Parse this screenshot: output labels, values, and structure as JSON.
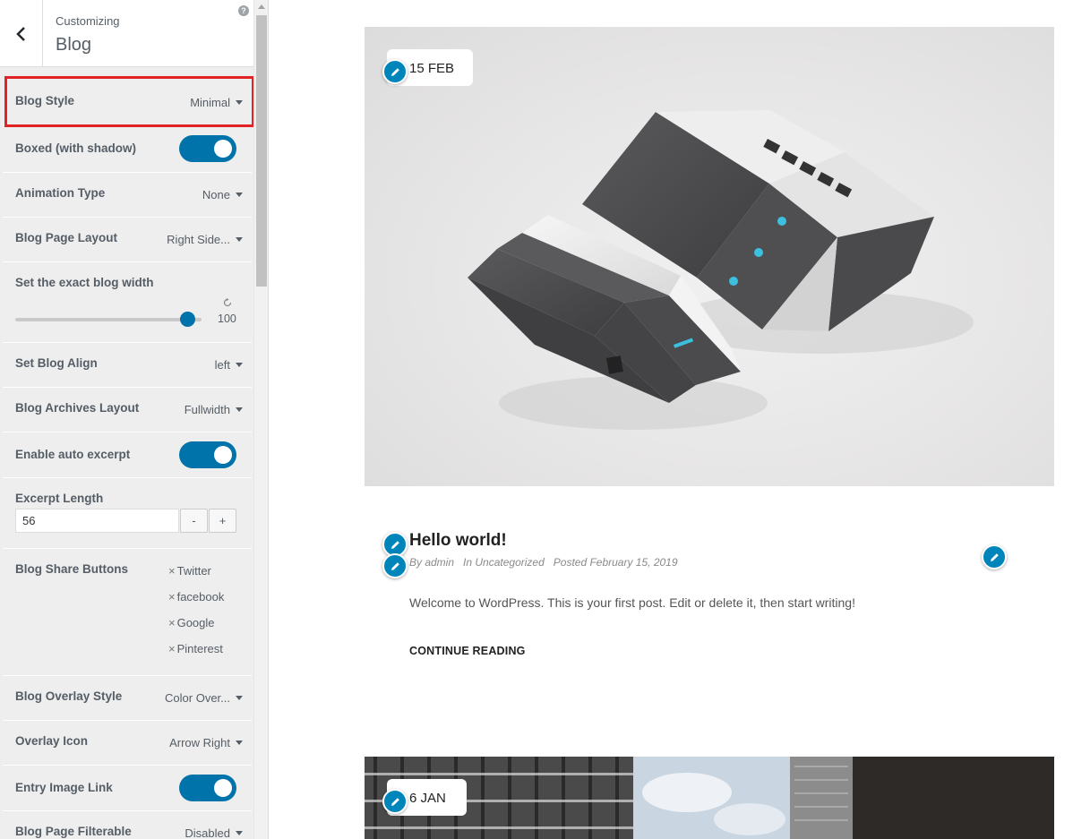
{
  "header": {
    "breadcrumb": "Customizing",
    "title": "Blog",
    "help_glyph": "?"
  },
  "controls": {
    "blog_style": {
      "label": "Blog Style",
      "value": "Minimal",
      "highlighted": true
    },
    "boxed": {
      "label": "Boxed (with shadow)",
      "enabled": true
    },
    "animation_type": {
      "label": "Animation Type",
      "value": "None"
    },
    "page_layout": {
      "label": "Blog Page Layout",
      "value": "Right Side..."
    },
    "blog_width": {
      "label": "Set the exact blog width",
      "value": "100",
      "fraction": 0.95
    },
    "blog_align": {
      "label": "Set Blog Align",
      "value": "left"
    },
    "archives_layout": {
      "label": "Blog Archives Layout",
      "value": "Fullwidth"
    },
    "auto_excerpt": {
      "label": "Enable auto excerpt",
      "enabled": true
    },
    "excerpt_length": {
      "label": "Excerpt Length",
      "value": "56",
      "minus": "-",
      "plus": "+"
    },
    "share_buttons": {
      "label": "Blog Share Buttons",
      "remove_glyph": "×",
      "items": [
        "Twitter",
        "facebook",
        "Google",
        "Pinterest"
      ]
    },
    "overlay_style": {
      "label": "Blog Overlay Style",
      "value": "Color Over..."
    },
    "overlay_icon": {
      "label": "Overlay Icon",
      "value": "Arrow Right"
    },
    "entry_image_link": {
      "label": "Entry Image Link",
      "enabled": true
    },
    "filterable": {
      "label": "Blog Page Filterable",
      "value": "Disabled"
    }
  },
  "preview": {
    "posts": [
      {
        "date": "15 FEB",
        "title": "Hello world!",
        "author": "By admin",
        "category": "In Uncategorized",
        "posted": "Posted February 15, 2019",
        "excerpt": "Welcome to WordPress. This is your first post. Edit or delete it, then start writing!",
        "read_more": "CONTINUE READING"
      },
      {
        "date": "6 JAN"
      }
    ]
  },
  "colors": {
    "accent": "#0073aa",
    "highlight": "#e32226",
    "sidebar_bg": "#eeeeee",
    "edit_pin": "#0085ba"
  },
  "icons": [
    "back-arrow-icon",
    "help-icon",
    "reset-icon",
    "pencil-icon",
    "caret-down-icon"
  ]
}
